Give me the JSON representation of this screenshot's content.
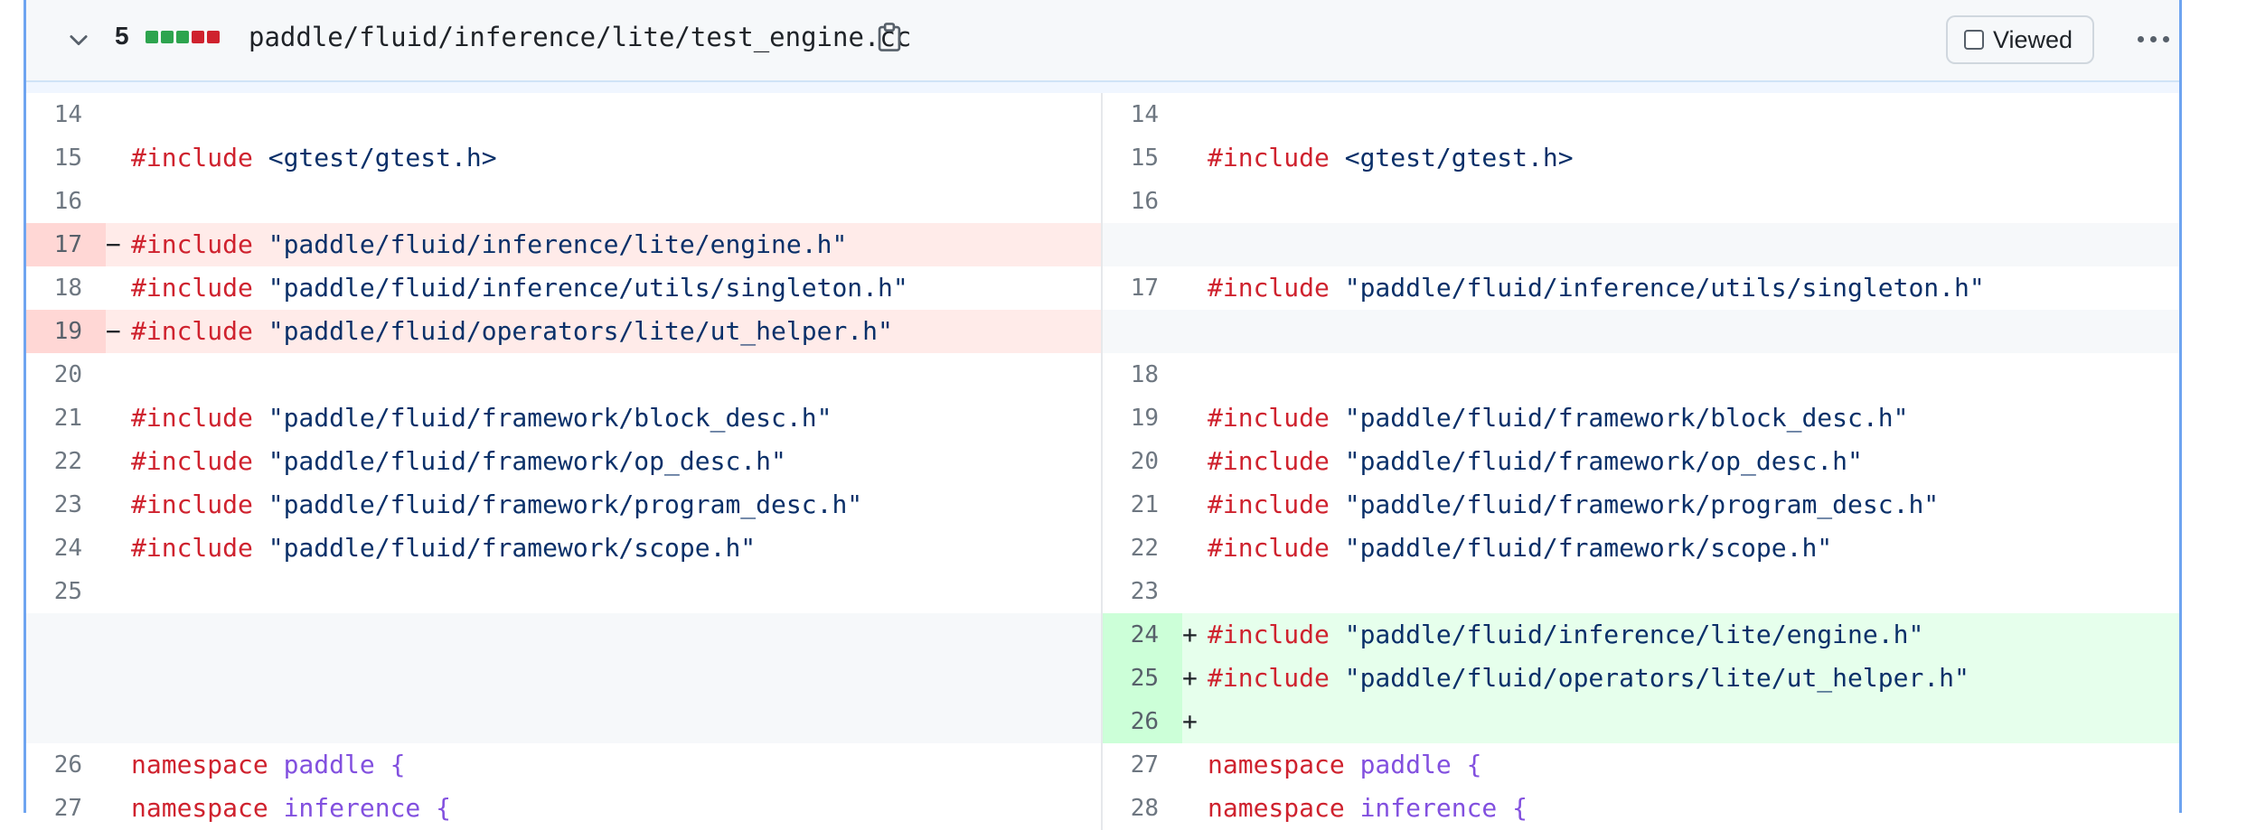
{
  "file": {
    "change_count": "5",
    "path": "paddle/fluid/inference/lite/test_engine.cc",
    "viewed_label": "Viewed",
    "diffstat": [
      "#2da44e",
      "#2da44e",
      "#2da44e",
      "#cf222e",
      "#cf222e"
    ]
  },
  "rows": [
    {
      "l_num": "14",
      "l_sign": "",
      "l_kw": "",
      "l_text": "",
      "l_type": "ctx",
      "r_num": "14",
      "r_sign": "",
      "r_kw": "",
      "r_text": "",
      "r_type": "ctx"
    },
    {
      "l_num": "15",
      "l_sign": "",
      "l_kw": "#include",
      "l_text": " <gtest/gtest.h>",
      "l_type": "ctx",
      "r_num": "15",
      "r_sign": "",
      "r_kw": "#include",
      "r_text": " <gtest/gtest.h>",
      "r_type": "ctx"
    },
    {
      "l_num": "16",
      "l_sign": "",
      "l_kw": "",
      "l_text": "",
      "l_type": "ctx",
      "r_num": "16",
      "r_sign": "",
      "r_kw": "",
      "r_text": "",
      "r_type": "ctx"
    },
    {
      "l_num": "17",
      "l_sign": "−",
      "l_kw": "#include",
      "l_text": " \"paddle/fluid/inference/lite/engine.h\"",
      "l_type": "del",
      "r_num": "",
      "r_sign": "",
      "r_kw": "",
      "r_text": "",
      "r_type": "empty"
    },
    {
      "l_num": "18",
      "l_sign": "",
      "l_kw": "#include",
      "l_text": " \"paddle/fluid/inference/utils/singleton.h\"",
      "l_type": "ctx",
      "r_num": "17",
      "r_sign": "",
      "r_kw": "#include",
      "r_text": " \"paddle/fluid/inference/utils/singleton.h\"",
      "r_type": "ctx"
    },
    {
      "l_num": "19",
      "l_sign": "−",
      "l_kw": "#include",
      "l_text": " \"paddle/fluid/operators/lite/ut_helper.h\"",
      "l_type": "del",
      "r_num": "",
      "r_sign": "",
      "r_kw": "",
      "r_text": "",
      "r_type": "empty"
    },
    {
      "l_num": "20",
      "l_sign": "",
      "l_kw": "",
      "l_text": "",
      "l_type": "ctx",
      "r_num": "18",
      "r_sign": "",
      "r_kw": "",
      "r_text": "",
      "r_type": "ctx"
    },
    {
      "l_num": "21",
      "l_sign": "",
      "l_kw": "#include",
      "l_text": " \"paddle/fluid/framework/block_desc.h\"",
      "l_type": "ctx",
      "r_num": "19",
      "r_sign": "",
      "r_kw": "#include",
      "r_text": " \"paddle/fluid/framework/block_desc.h\"",
      "r_type": "ctx"
    },
    {
      "l_num": "22",
      "l_sign": "",
      "l_kw": "#include",
      "l_text": " \"paddle/fluid/framework/op_desc.h\"",
      "l_type": "ctx",
      "r_num": "20",
      "r_sign": "",
      "r_kw": "#include",
      "r_text": " \"paddle/fluid/framework/op_desc.h\"",
      "r_type": "ctx"
    },
    {
      "l_num": "23",
      "l_sign": "",
      "l_kw": "#include",
      "l_text": " \"paddle/fluid/framework/program_desc.h\"",
      "l_type": "ctx",
      "r_num": "21",
      "r_sign": "",
      "r_kw": "#include",
      "r_text": " \"paddle/fluid/framework/program_desc.h\"",
      "r_type": "ctx"
    },
    {
      "l_num": "24",
      "l_sign": "",
      "l_kw": "#include",
      "l_text": " \"paddle/fluid/framework/scope.h\"",
      "l_type": "ctx",
      "r_num": "22",
      "r_sign": "",
      "r_kw": "#include",
      "r_text": " \"paddle/fluid/framework/scope.h\"",
      "r_type": "ctx"
    },
    {
      "l_num": "25",
      "l_sign": "",
      "l_kw": "",
      "l_text": "",
      "l_type": "ctx",
      "r_num": "23",
      "r_sign": "",
      "r_kw": "",
      "r_text": "",
      "r_type": "ctx"
    },
    {
      "l_num": "",
      "l_sign": "",
      "l_kw": "",
      "l_text": "",
      "l_type": "empty",
      "r_num": "24",
      "r_sign": "+",
      "r_kw": "#include",
      "r_text": " \"paddle/fluid/inference/lite/engine.h\"",
      "r_type": "add"
    },
    {
      "l_num": "",
      "l_sign": "",
      "l_kw": "",
      "l_text": "",
      "l_type": "empty",
      "r_num": "25",
      "r_sign": "+",
      "r_kw": "#include",
      "r_text": " \"paddle/fluid/operators/lite/ut_helper.h\"",
      "r_type": "add"
    },
    {
      "l_num": "",
      "l_sign": "",
      "l_kw": "",
      "l_text": "",
      "l_type": "empty",
      "r_num": "26",
      "r_sign": "+",
      "r_kw": "",
      "r_text": "",
      "r_type": "add"
    },
    {
      "l_num": "26",
      "l_sign": "",
      "l_kw": "namespace",
      "l_text": " paddle {",
      "l_type": "ctx",
      "r_num": "27",
      "r_sign": "",
      "r_kw": "namespace",
      "r_text": " paddle {",
      "r_type": "ctx"
    },
    {
      "l_num": "27",
      "l_sign": "",
      "l_kw": "namespace",
      "l_text": " inference {",
      "l_type": "ctx",
      "r_num": "28",
      "r_sign": "",
      "r_kw": "namespace",
      "r_text": " inference {",
      "r_type": "ctx"
    }
  ]
}
